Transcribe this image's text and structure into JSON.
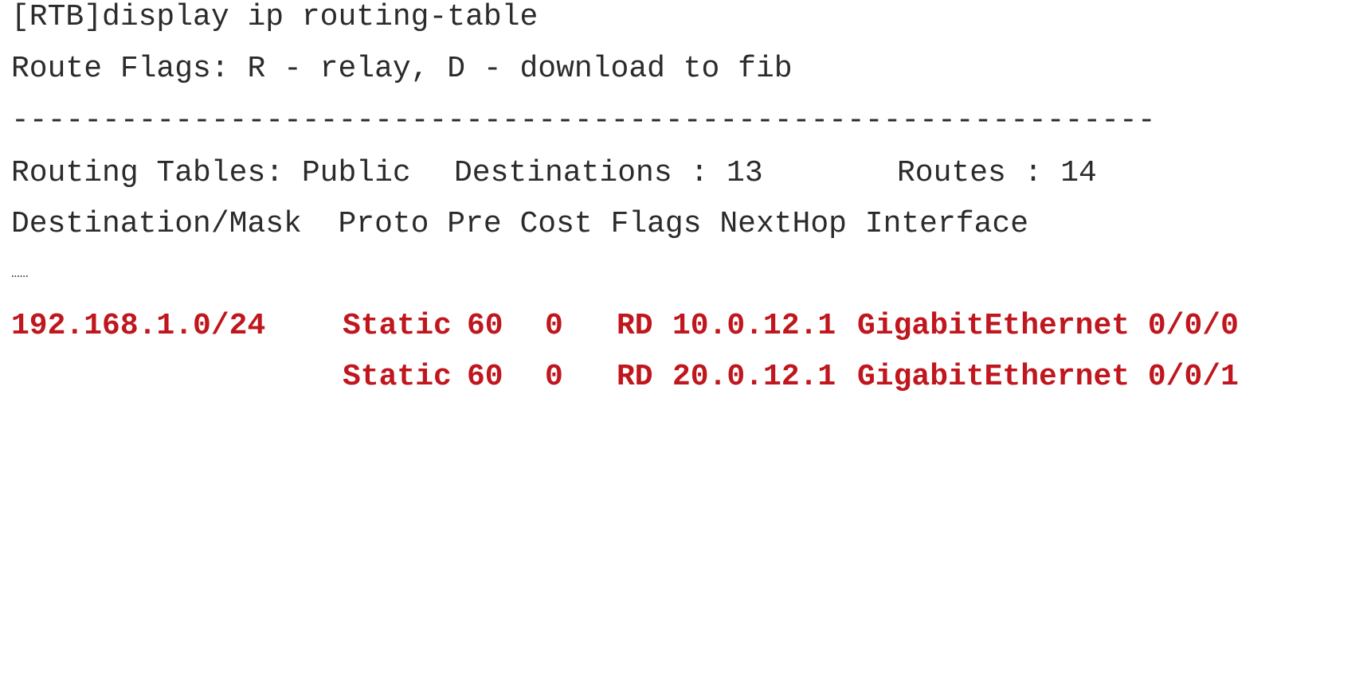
{
  "terminal": {
    "command": "[RTB]display ip routing-table",
    "flags_legend": "Route Flags: R - relay, D - download to fib",
    "separator": "------------------------------------------------------------------------------",
    "summary": {
      "tables_label": "Routing Tables: Public",
      "destinations": "Destinations : 13",
      "routes": "Routes : 14"
    },
    "header": "Destination/Mask  Proto Pre Cost Flags NextHop Interface",
    "ellipsis": "……",
    "routes": [
      {
        "destination": "192.168.1.0/24",
        "proto": "Static",
        "pre": "60",
        "cost": "0",
        "flags": "RD",
        "nexthop": "10.0.12.1",
        "interface": "GigabitEthernet 0/0/0"
      },
      {
        "destination": "",
        "proto": "Static",
        "pre": "60",
        "cost": "0",
        "flags": "RD",
        "nexthop": "20.0.12.1",
        "interface": "GigabitEthernet 0/0/1"
      }
    ],
    "colors": {
      "text": "#2b2b2b",
      "highlight": "#c0161d",
      "background": "#ffffff"
    }
  }
}
